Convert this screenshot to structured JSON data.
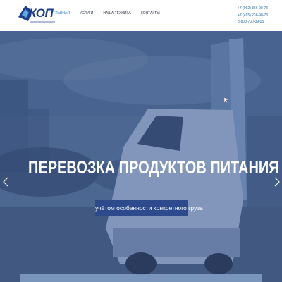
{
  "header": {
    "logo_text": "КОП",
    "nav": [
      {
        "label": "главная",
        "active": true
      },
      {
        "label": "услуги",
        "active": false
      },
      {
        "label": "наша техника",
        "active": false
      },
      {
        "label": "контакты",
        "active": false
      }
    ],
    "phones": [
      "+7 (962) 366-98-73",
      "+7 (495) 236-98-73",
      "8-800-700-39-05"
    ]
  },
  "hero": {
    "title": "ПЕРЕВОЗКА ПРОДУКТОВ ПИТАНИЯ",
    "subtitle": "учётом особенности конкретного груза"
  },
  "colors": {
    "brand": "#1d3f8c",
    "nav_active": "#2b7bc4",
    "phone": "#2b6cb0",
    "subtitle_bg": "#2d4a8c"
  },
  "icons": {
    "prev": "chevron-left-icon",
    "next": "chevron-right-icon"
  }
}
